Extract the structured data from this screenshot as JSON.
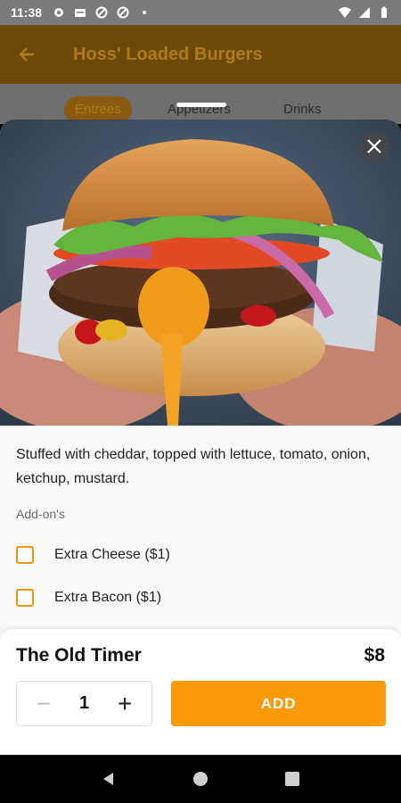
{
  "status_bar": {
    "time": "11:38",
    "left_icons": [
      "gear-icon",
      "card-icon",
      "blocked-icon",
      "blocked-icon-2",
      "dot-icon"
    ],
    "right_icons": [
      "wifi-icon",
      "signal-icon",
      "battery-icon"
    ]
  },
  "app_bar": {
    "title": "Hoss' Loaded Burgers",
    "back_icon": "arrow-left-icon"
  },
  "tabs": [
    {
      "label": "Entrees",
      "active": true
    },
    {
      "label": "Appetizers",
      "active": false
    },
    {
      "label": "Drinks",
      "active": false
    }
  ],
  "sheet": {
    "description": "Stuffed with cheddar, topped with lettuce, tomato, onion, ketchup, mustard.",
    "addons_label": "Add-on's",
    "addons": [
      {
        "label": "Extra Cheese ($1)",
        "checked": false
      },
      {
        "label": "Extra Bacon ($1)",
        "checked": false
      }
    ],
    "item_name": "The Old Timer",
    "price": "$8",
    "quantity": "1",
    "add_label": "ADD",
    "minus_symbol": "−",
    "plus_symbol": "+"
  },
  "colors": {
    "accent": "#f89a0a",
    "checkbox": "#f0960c"
  }
}
